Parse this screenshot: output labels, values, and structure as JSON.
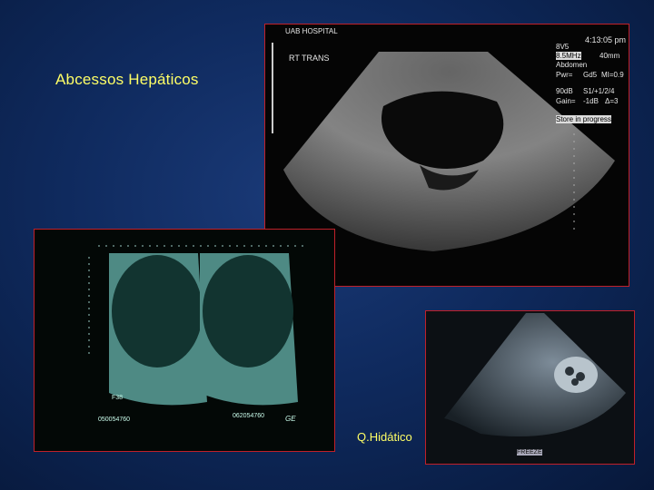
{
  "slide": {
    "title": "Abcessos Hepáticos",
    "caption": "Q.Hidático",
    "colors": {
      "background": "#0f2a5e",
      "text": "#ffff66",
      "frame": "#c0202a"
    }
  },
  "ultrasound_top": {
    "hospital": "UAB HOSPITAL",
    "label": "RT TRANS",
    "time": "4:13:05 pm",
    "settings": [
      "8V5",
      "8.5MHz",
      "40mm",
      "Abdomen",
      "Pwr=",
      "Gd5",
      "MI=0.9",
      "90dB",
      "S1/+1/2/4",
      "Gain=",
      "-1dB",
      "Δ=3"
    ],
    "status": "Store in progress"
  },
  "ultrasound_left": {
    "ids": [
      "050054760",
      "062054760"
    ],
    "label": "F38",
    "logo": "GE"
  },
  "ultrasound_right": {
    "status": "FREEZE"
  }
}
